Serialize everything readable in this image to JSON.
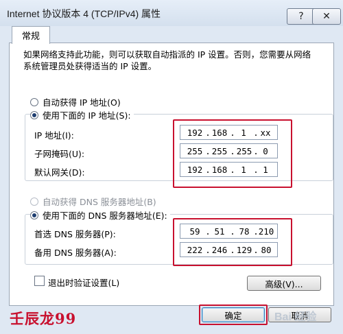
{
  "window": {
    "title": "Internet 协议版本 4 (TCP/IPv4) 属性",
    "help_symbol": "?",
    "close_symbol": "✕"
  },
  "tabs": [
    {
      "label": "常规"
    }
  ],
  "intro_text": "如果网络支持此功能，则可以获取自动指派的 IP 设置。否则，您需要从网络系统管理员处获得适当的 IP 设置。",
  "ip": {
    "auto_label": "自动获得 IP 地址(O)",
    "manual_label": "使用下面的 IP 地址(S):",
    "selected": "manual",
    "address_label": "IP 地址(I):",
    "address": [
      "192",
      "168",
      "1",
      "xx"
    ],
    "mask_label": "子网掩码(U):",
    "mask": [
      "255",
      "255",
      "255",
      "0"
    ],
    "gateway_label": "默认网关(D):",
    "gateway": [
      "192",
      "168",
      "1",
      "1"
    ]
  },
  "dns": {
    "auto_label": "自动获得 DNS 服务器地址(B)",
    "manual_label": "使用下面的 DNS 服务器地址(E):",
    "selected": "manual",
    "preferred_label": "首选 DNS 服务器(P):",
    "preferred": [
      "59",
      "51",
      "78",
      "210"
    ],
    "alternate_label": "备用 DNS 服务器(A):",
    "alternate": [
      "222",
      "246",
      "129",
      "80"
    ]
  },
  "validate_label": "退出时验证设置(L)",
  "validate_checked": false,
  "advanced_label": "高级(V)...",
  "ok_label": "确定",
  "cancel_label": "取消",
  "watermark": "壬辰龙99",
  "baidu_watermark": "Bai 经验",
  "colors": {
    "highlight": "#c8102e",
    "panel": "#ffffff",
    "frame": "#dfe8f3"
  }
}
